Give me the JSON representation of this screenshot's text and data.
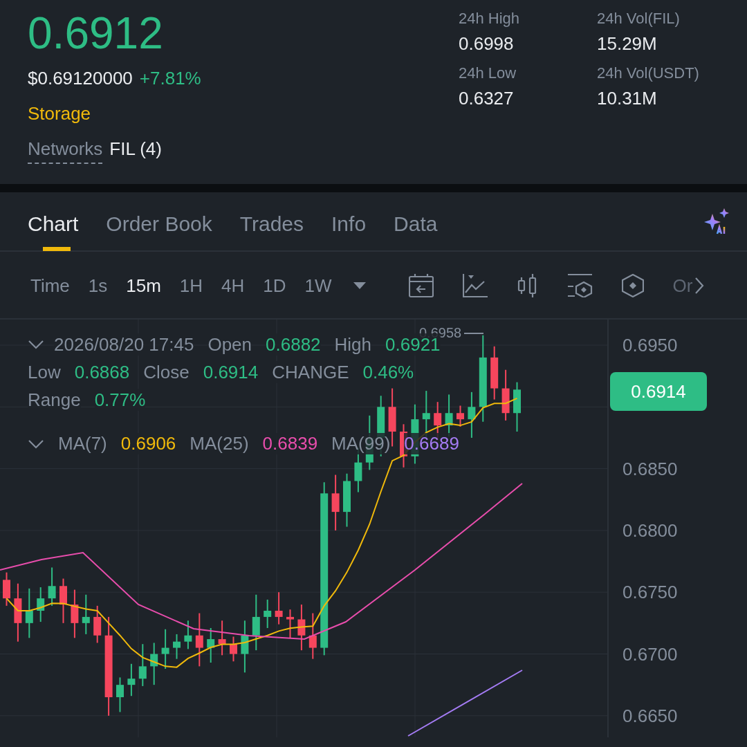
{
  "ticker": {
    "price": "0.6912",
    "fiat_price": "$0.69120000",
    "change": "+7.81%",
    "tag": "Storage",
    "networks_label": "Networks",
    "networks_value": "FIL (4)"
  },
  "stats": [
    {
      "label": "24h High",
      "value": "0.6998"
    },
    {
      "label": "24h Vol(FIL)",
      "value": "15.29M"
    },
    {
      "label": "24h Low",
      "value": "0.6327"
    },
    {
      "label": "24h Vol(USDT)",
      "value": "10.31M"
    }
  ],
  "tabs": [
    {
      "label": "Chart",
      "selected": true
    },
    {
      "label": "Order Book",
      "selected": false
    },
    {
      "label": "Trades",
      "selected": false
    },
    {
      "label": "Info",
      "selected": false
    },
    {
      "label": "Data",
      "selected": false
    }
  ],
  "intervals": [
    {
      "label": "Time",
      "selected": false
    },
    {
      "label": "1s",
      "selected": false
    },
    {
      "label": "15m",
      "selected": true
    },
    {
      "label": "1H",
      "selected": false
    },
    {
      "label": "4H",
      "selected": false
    },
    {
      "label": "1D",
      "selected": false
    },
    {
      "label": "1W",
      "selected": false
    }
  ],
  "toolbar_overflow": "Or",
  "ohlc": {
    "date": "2026/08/20 17:45",
    "fields": [
      {
        "label": "Open",
        "value": "0.6882"
      },
      {
        "label": "High",
        "value": "0.6921"
      },
      {
        "label": "Low",
        "value": "0.6868"
      },
      {
        "label": "Close",
        "value": "0.6914"
      },
      {
        "label": "CHANGE",
        "value": "0.46%"
      },
      {
        "label": "Range",
        "value": "0.77%"
      }
    ]
  },
  "moving_averages": [
    {
      "label": "MA(7)",
      "value": "0.6906",
      "color": "#f0b90b"
    },
    {
      "label": "MA(25)",
      "value": "0.6839",
      "color": "#e84dac"
    },
    {
      "label": "MA(99)",
      "value": "0.6689",
      "color": "#a57cf5"
    }
  ],
  "high_marker": "0.6958",
  "price_axis": [
    "0.6950",
    "0.6850",
    "0.6800",
    "0.6750",
    "0.6700",
    "0.6650"
  ],
  "current_price": "0.6914"
}
